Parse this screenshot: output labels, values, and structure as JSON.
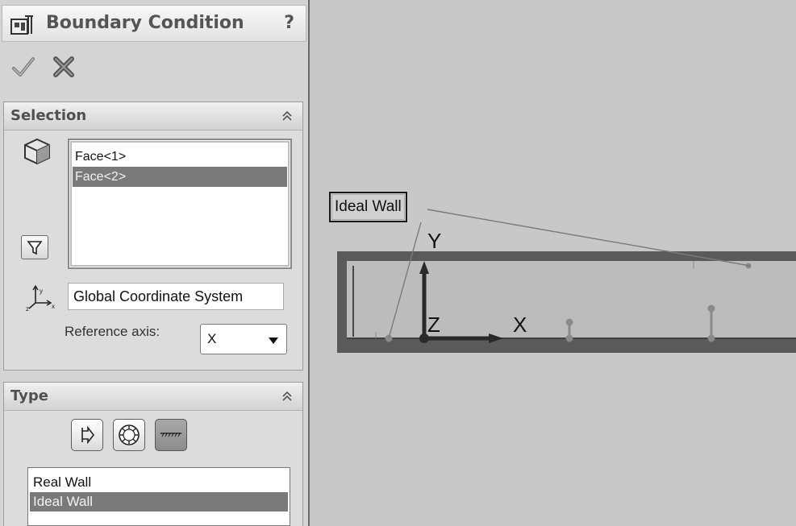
{
  "window": {
    "title": "Boundary Condition",
    "help": "?"
  },
  "actions": {
    "ok_icon": "checkmark-icon",
    "cancel_icon": "x-icon"
  },
  "selection": {
    "title": "Selection",
    "faces": [
      {
        "label": "Face<1>",
        "selected": false
      },
      {
        "label": "Face<2>",
        "selected": true
      }
    ],
    "coordinate_system": "Global Coordinate System",
    "reference_axis_label": "Reference axis:",
    "reference_axis_value": "X"
  },
  "type": {
    "title": "Type",
    "icons": [
      "inlet-outlet-icon",
      "pressure-opening-icon",
      "wall-icon"
    ],
    "active_icon": "wall-icon",
    "items": [
      {
        "label": "Real Wall",
        "selected": false
      },
      {
        "label": "Ideal Wall",
        "selected": true
      }
    ]
  },
  "viewport": {
    "callout": "Ideal Wall",
    "axes": {
      "y": "Y",
      "z": "Z",
      "x": "X"
    }
  },
  "colors": {
    "panel_bg": "#d4d4d4",
    "selection_highlight": "#7a7a7a",
    "viewport_bg": "#c8c8c8"
  }
}
